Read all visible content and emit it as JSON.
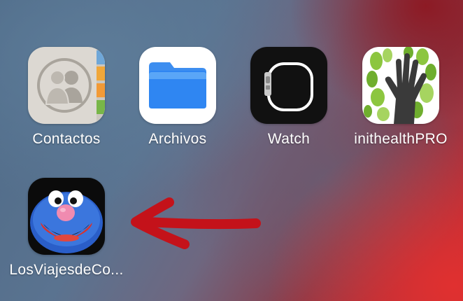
{
  "home_screen": {
    "apps": [
      {
        "label": "Contactos",
        "icon": "contacts-icon"
      },
      {
        "label": "Archivos",
        "icon": "files-folder-icon"
      },
      {
        "label": "Watch",
        "icon": "apple-watch-icon"
      },
      {
        "label": "inithealthPRO",
        "icon": "hand-tree-icon"
      },
      {
        "label": "LosViajesdeCo...",
        "icon": "blue-monster-icon"
      }
    ],
    "annotation": {
      "icon": "red-arrow-icon",
      "color": "#c4121a"
    }
  }
}
